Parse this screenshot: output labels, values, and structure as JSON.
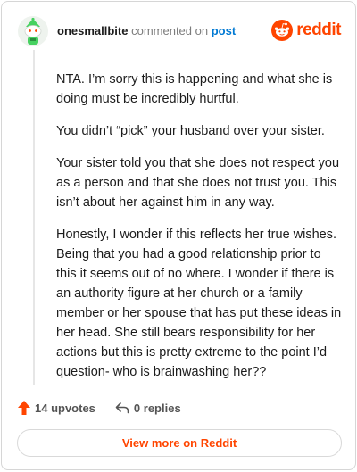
{
  "header": {
    "username": "onesmallbite",
    "action_text": "commented on",
    "post_link_text": "post",
    "brand_text": "reddit"
  },
  "comment": {
    "paragraphs": [
      "NTA. I’m sorry this is happening and what she is doing must be incredibly hurtful.",
      "You didn’t “pick” your husband over your sister.",
      "Your sister told you that she does not respect you as a person and that she does not trust you. This isn’t about her against him in any way.",
      "Honestly, I wonder if this reflects her true wishes. Being that you had a good relationship prior to this it seems out of no where. I wonder if there is an authority figure at her church or a family member or her spouse that has put these ideas in her head. She still bears responsibility for her actions but this is pretty extreme to the point I’d question- who is brainwashing her??"
    ]
  },
  "footer": {
    "upvotes_label": "14 upvotes",
    "replies_label": "0 replies",
    "view_more_label": "View more on Reddit"
  },
  "colors": {
    "brand": "#ff4500",
    "link": "#0079d3",
    "avatar_accent": "#46d160"
  }
}
